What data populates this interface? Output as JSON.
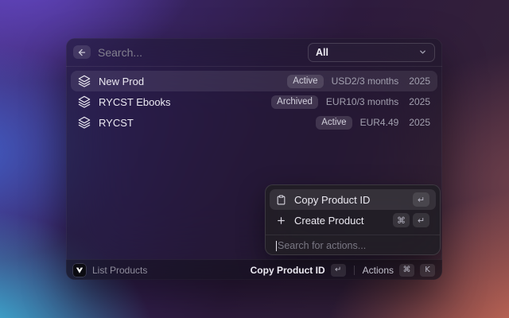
{
  "window": {
    "search": {
      "placeholder": "Search..."
    },
    "filter": {
      "selected": "All"
    },
    "products": [
      {
        "name": "New Prod",
        "status": "Active",
        "price": "USD2/3 months",
        "year": "2025"
      },
      {
        "name": "RYCST Ebooks",
        "status": "Archived",
        "price": "EUR10/3 months",
        "year": "2025"
      },
      {
        "name": "RYCST",
        "status": "Active",
        "price": "EUR4.49",
        "year": "2025"
      }
    ]
  },
  "actions_popup": {
    "items": [
      {
        "label": "Copy Product ID",
        "icon": "clipboard-icon",
        "keys": [
          "↵"
        ]
      },
      {
        "label": "Create Product",
        "icon": "plus-icon",
        "keys": [
          "⌘",
          "↵"
        ]
      }
    ],
    "search": {
      "placeholder": "Search for actions..."
    }
  },
  "footer": {
    "command_title": "List Products",
    "primary_action": {
      "label": "Copy Product ID",
      "key": "↵"
    },
    "actions_button": {
      "label": "Actions",
      "keys": [
        "⌘",
        "K"
      ]
    }
  },
  "icons": {
    "back": "arrow-left",
    "filter_chevron": "chevron-down",
    "product": "layers",
    "copy": "clipboard",
    "create": "plus",
    "logo": "v-triangle"
  },
  "colors": {
    "gradient_top_left": "#6346c4",
    "gradient_left": "#4063ce",
    "gradient_bottom_left": "#3ecdec",
    "gradient_bottom_right": "#e97a5d",
    "gradient_base": "#2e1b3e",
    "selection_bg": "rgba(255,255,255,0.09)",
    "badge_bg": "rgba(255,255,255,0.13)"
  }
}
